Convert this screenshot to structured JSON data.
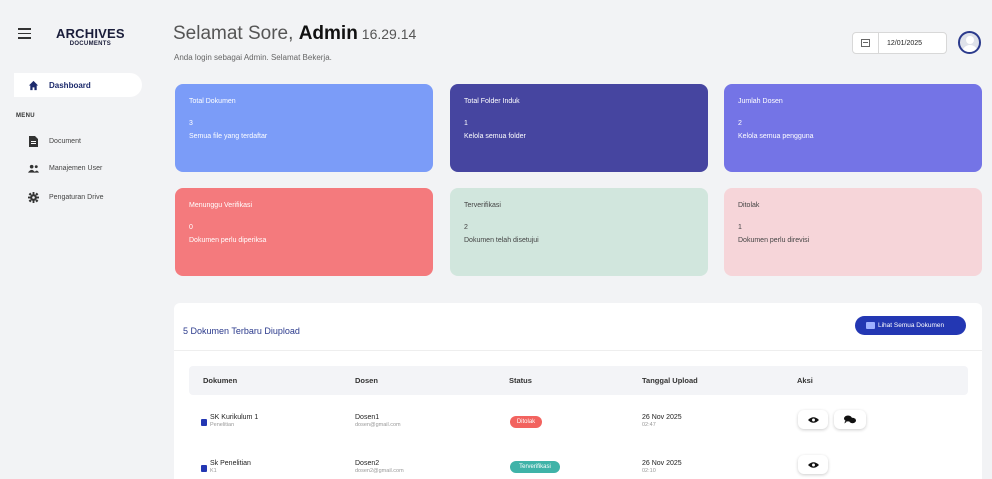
{
  "brand": {
    "title": "ARCHIVES",
    "subtitle": "DOCUMENTS"
  },
  "sidebar": {
    "active": {
      "label": "Dashboard",
      "icon": "home-icon"
    },
    "menu_heading": "MENU",
    "items": [
      {
        "label": "Document",
        "icon": "document-icon"
      },
      {
        "label": "Manajemen User",
        "icon": "users-icon"
      },
      {
        "label": "Pengaturan Drive",
        "icon": "gear-icon"
      }
    ]
  },
  "header": {
    "greeting": "Selamat Sore,",
    "user": "Admin",
    "time": "16.29.14",
    "subtitle": "Anda login sebagai Admin. Selamat Bekerja.",
    "date": "12/01/2025"
  },
  "cards": [
    {
      "title": "Total Dokumen",
      "value": "3",
      "desc": "Semua file yang terdaftar",
      "color": "#7b9cf8"
    },
    {
      "title": "Total Folder Induk",
      "value": "1",
      "desc": "Kelola semua folder",
      "color": "#4645a0"
    },
    {
      "title": "Jumlah Dosen",
      "value": "2",
      "desc": "Kelola semua pengguna",
      "color": "#7474e6"
    },
    {
      "title": "Menunggu Verifikasi",
      "value": "0",
      "desc": "Dokumen perlu diperiksa",
      "color": "#f47a7d"
    },
    {
      "title": "Terverifikasi",
      "value": "2",
      "desc": "Dokumen telah disetujui",
      "color": "#d1e6dd"
    },
    {
      "title": "Ditolak",
      "value": "1",
      "desc": "Dokumen perlu direvisi",
      "color": "#f6d5d9"
    }
  ],
  "recent": {
    "title": "5 Dokumen Terbaru Diupload",
    "button": "Lihat Semua Dokumen",
    "columns": [
      "Dokumen",
      "Dosen",
      "Status",
      "Tanggal Upload",
      "Aksi"
    ],
    "rows": [
      {
        "doc": "SK Kurikulum 1",
        "doc_sub": "Penelitian",
        "dosen": "Dosen1",
        "email": "dosen@gmail.com",
        "status": "Ditolak",
        "status_color": "#f2635f",
        "date": "26 Nov 2025",
        "time": "02:47"
      },
      {
        "doc": "Sk Penelitian",
        "doc_sub": "K1",
        "dosen": "Dosen2",
        "email": "dosen2@gmail.com",
        "status": "Terverifikasi",
        "status_color": "#3fb3a8",
        "date": "26 Nov 2025",
        "time": "02:10"
      }
    ]
  }
}
